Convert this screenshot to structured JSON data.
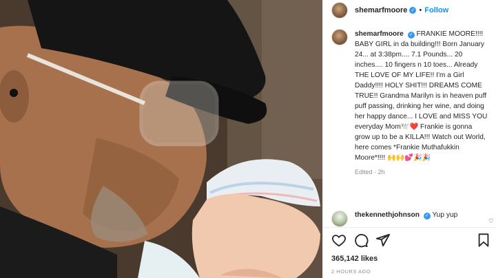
{
  "post": {
    "photo_alt": "Man in black cap and clear glasses looking at newborn baby in striped hat",
    "author": "shemarfmoore",
    "verified": true,
    "separator": "•",
    "follow_label": "Follow",
    "more_label": "•••",
    "caption": "FRANKIE MOORE!!!! BABY GIRL in da building!!! Born January 24... at 3:38pm.... 7.1 Pounds... 20 inches.... 10 fingers n 10 toes... Already THE LOVE OF MY LIFE!! I'm a Girl Daddy!!!! HOLY SHIT!!! DREAMS COME TRUE!! Grandma Marilyn is in heaven puff puff passing, drinking her wine, and doing her happy dance... I LOVE and MISS YOU everyday Mom🕊️❤️ Frankie is gonna grow up to be a KILLA!!! Watch out World, here comes *Frankie Muthafukkin Moore*!!!! 🙌🙌💕🎉🎉",
    "caption_meta": "Edited · 2h",
    "comment": {
      "author": "thekennethjohnson",
      "text": "Yup yup",
      "heart": "♡"
    },
    "likes": "365,142 likes",
    "timestamp": "2 HOURS AGO"
  },
  "icons": {
    "like": "heart-icon",
    "comment": "comment-icon",
    "share": "share-icon",
    "save": "bookmark-icon"
  }
}
